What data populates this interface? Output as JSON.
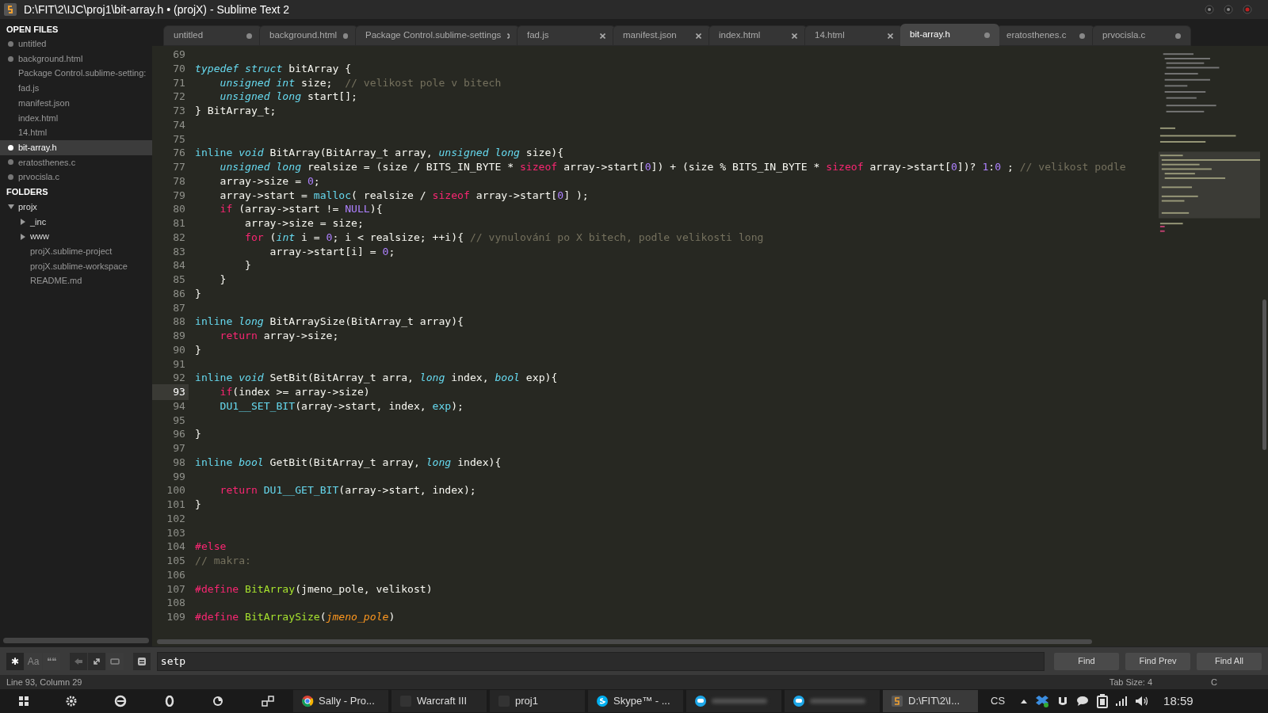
{
  "window": {
    "title": "D:\\FIT\\2\\IJC\\proj1\\bit-array.h • (projX) - Sublime Text 2"
  },
  "tabs": [
    {
      "label": "untitled",
      "selected": false,
      "modified": true
    },
    {
      "label": "background.html",
      "selected": false,
      "modified": true
    },
    {
      "label": "Package Control.sublime-settings",
      "selected": false,
      "modified": false
    },
    {
      "label": "fad.js",
      "selected": false,
      "modified": false
    },
    {
      "label": "manifest.json",
      "selected": false,
      "modified": false
    },
    {
      "label": "index.html",
      "selected": false,
      "modified": false
    },
    {
      "label": "14.html",
      "selected": false,
      "modified": false
    },
    {
      "label": "bit-array.h",
      "selected": true,
      "modified": true
    },
    {
      "label": "eratosthenes.c",
      "selected": false,
      "modified": true
    },
    {
      "label": "prvocisla.c",
      "selected": false,
      "modified": true
    }
  ],
  "sidebar": {
    "open_files_heading": "OPEN FILES",
    "open_files": [
      {
        "label": "untitled",
        "selected": false,
        "modified": true
      },
      {
        "label": "background.html",
        "selected": false,
        "modified": true
      },
      {
        "label": "Package Control.sublime-setting:",
        "selected": false,
        "modified": false
      },
      {
        "label": "fad.js",
        "selected": false,
        "modified": false
      },
      {
        "label": "manifest.json",
        "selected": false,
        "modified": false
      },
      {
        "label": "index.html",
        "selected": false,
        "modified": false
      },
      {
        "label": "14.html",
        "selected": false,
        "modified": false
      },
      {
        "label": "bit-array.h",
        "selected": true,
        "modified": true
      },
      {
        "label": "eratosthenes.c",
        "selected": false,
        "modified": true
      },
      {
        "label": "prvocisla.c",
        "selected": false,
        "modified": true
      }
    ],
    "folders_heading": "FOLDERS",
    "folders": [
      {
        "label": "projx",
        "kind": "folder",
        "expanded": true,
        "children": [
          {
            "label": "_inc",
            "kind": "folder",
            "expanded": false
          },
          {
            "label": "www",
            "kind": "folder",
            "expanded": false
          },
          {
            "label": "projX.sublime-project",
            "kind": "file"
          },
          {
            "label": "projX.sublime-workspace",
            "kind": "file"
          },
          {
            "label": "README.md",
            "kind": "file"
          }
        ]
      }
    ]
  },
  "editor": {
    "lines": [
      {
        "number": "69",
        "current": false
      },
      {
        "number": "70",
        "current": false,
        "tokens": [
          {
            "kind": "type",
            "text": "typedef struct"
          },
          {
            "kind": "plain",
            "text": " bitArray {"
          }
        ]
      },
      {
        "number": "71",
        "current": false,
        "tokens": [
          {
            "kind": "type",
            "text": "    unsigned int"
          },
          {
            "kind": "plain",
            "text": " size;  "
          },
          {
            "kind": "comment",
            "text": "// velikost pole v bitech"
          }
        ]
      },
      {
        "number": "72",
        "current": false,
        "tokens": [
          {
            "kind": "type",
            "text": "    unsigned long"
          },
          {
            "kind": "plain",
            "text": " start[];"
          }
        ]
      },
      {
        "number": "73",
        "current": false,
        "tokens": [
          {
            "kind": "plain",
            "text": "} BitArray_t;"
          }
        ]
      },
      {
        "number": "74",
        "current": false
      },
      {
        "number": "75",
        "current": false
      },
      {
        "number": "76",
        "current": false,
        "tokens": [
          {
            "kind": "storage",
            "text": "inline"
          },
          {
            "kind": "type",
            "text": " void"
          },
          {
            "kind": "plain",
            "text": " BitArray(BitArray_t array, "
          },
          {
            "kind": "type",
            "text": "unsigned long"
          },
          {
            "kind": "plain",
            "text": " size){"
          }
        ]
      },
      {
        "number": "77",
        "current": false,
        "tokens": [
          {
            "kind": "type",
            "text": "    unsigned long"
          },
          {
            "kind": "plain",
            "text": " realsize = (size / BITS_IN_BYTE * "
          },
          {
            "kind": "keyword",
            "text": "sizeof"
          },
          {
            "kind": "plain",
            "text": " array->start["
          },
          {
            "kind": "number",
            "text": "0"
          },
          {
            "kind": "plain",
            "text": "]) + (size % BITS_IN_BYTE * "
          },
          {
            "kind": "keyword",
            "text": "sizeof"
          },
          {
            "kind": "plain",
            "text": " array->start["
          },
          {
            "kind": "number",
            "text": "0"
          },
          {
            "kind": "plain",
            "text": "])? "
          },
          {
            "kind": "number",
            "text": "1"
          },
          {
            "kind": "plain",
            "text": ":"
          },
          {
            "kind": "number",
            "text": "0"
          },
          {
            "kind": "plain",
            "text": " ; "
          },
          {
            "kind": "comment",
            "text": "// velikost podle"
          }
        ]
      },
      {
        "number": "78",
        "current": false,
        "tokens": [
          {
            "kind": "plain",
            "text": "    array->size = "
          },
          {
            "kind": "number",
            "text": "0"
          },
          {
            "kind": "plain",
            "text": ";"
          }
        ]
      },
      {
        "number": "79",
        "current": false,
        "tokens": [
          {
            "kind": "plain",
            "text": "    array->start = "
          },
          {
            "kind": "func",
            "text": "malloc"
          },
          {
            "kind": "plain",
            "text": "( realsize / "
          },
          {
            "kind": "keyword",
            "text": "sizeof"
          },
          {
            "kind": "plain",
            "text": " array->start["
          },
          {
            "kind": "number",
            "text": "0"
          },
          {
            "kind": "plain",
            "text": "] );"
          }
        ]
      },
      {
        "number": "80",
        "current": false,
        "tokens": [
          {
            "kind": "keyword",
            "text": "    if"
          },
          {
            "kind": "plain",
            "text": " (array->start != "
          },
          {
            "kind": "number",
            "text": "NULL"
          },
          {
            "kind": "plain",
            "text": "){"
          }
        ]
      },
      {
        "number": "81",
        "current": false,
        "tokens": [
          {
            "kind": "plain",
            "text": "        array->size = size;"
          }
        ]
      },
      {
        "number": "82",
        "current": false,
        "tokens": [
          {
            "kind": "keyword",
            "text": "        for"
          },
          {
            "kind": "plain",
            "text": " ("
          },
          {
            "kind": "type",
            "text": "int"
          },
          {
            "kind": "plain",
            "text": " i = "
          },
          {
            "kind": "number",
            "text": "0"
          },
          {
            "kind": "plain",
            "text": "; i < realsize; ++i){ "
          },
          {
            "kind": "comment",
            "text": "// vynulování po X bitech, podle velikosti long"
          }
        ]
      },
      {
        "number": "83",
        "current": false,
        "tokens": [
          {
            "kind": "plain",
            "text": "            array->start[i] = "
          },
          {
            "kind": "number",
            "text": "0"
          },
          {
            "kind": "plain",
            "text": ";"
          }
        ]
      },
      {
        "number": "84",
        "current": false,
        "tokens": [
          {
            "kind": "plain",
            "text": "        }"
          }
        ]
      },
      {
        "number": "85",
        "current": false,
        "tokens": [
          {
            "kind": "plain",
            "text": "    }"
          }
        ]
      },
      {
        "number": "86",
        "current": false,
        "tokens": [
          {
            "kind": "plain",
            "text": "}"
          }
        ]
      },
      {
        "number": "87",
        "current": false
      },
      {
        "number": "88",
        "current": false,
        "tokens": [
          {
            "kind": "storage",
            "text": "inline"
          },
          {
            "kind": "type",
            "text": " long"
          },
          {
            "kind": "plain",
            "text": " BitArraySize(BitArray_t array){"
          }
        ]
      },
      {
        "number": "89",
        "current": false,
        "tokens": [
          {
            "kind": "keyword",
            "text": "    return"
          },
          {
            "kind": "plain",
            "text": " array->size;"
          }
        ]
      },
      {
        "number": "90",
        "current": false,
        "tokens": [
          {
            "kind": "plain",
            "text": "}"
          }
        ]
      },
      {
        "number": "91",
        "current": false
      },
      {
        "number": "92",
        "current": false,
        "tokens": [
          {
            "kind": "storage",
            "text": "inline"
          },
          {
            "kind": "type",
            "text": " void"
          },
          {
            "kind": "plain",
            "text": " SetBit(BitArray_t arra, "
          },
          {
            "kind": "type",
            "text": "long"
          },
          {
            "kind": "plain",
            "text": " index, "
          },
          {
            "kind": "type",
            "text": "bool"
          },
          {
            "kind": "plain",
            "text": " exp){"
          }
        ]
      },
      {
        "number": "93",
        "current": true,
        "tokens": [
          {
            "kind": "keyword",
            "text": "    if"
          },
          {
            "kind": "plain",
            "text": "(index >= array->size)"
          }
        ]
      },
      {
        "number": "94",
        "current": false,
        "tokens": [
          {
            "kind": "func",
            "text": "    DU1__SET_BIT"
          },
          {
            "kind": "plain",
            "text": "(array->start, index, "
          },
          {
            "kind": "func",
            "text": "exp"
          },
          {
            "kind": "plain",
            "text": ");"
          }
        ]
      },
      {
        "number": "95",
        "current": false
      },
      {
        "number": "96",
        "current": false,
        "tokens": [
          {
            "kind": "plain",
            "text": "}"
          }
        ]
      },
      {
        "number": "97",
        "current": false
      },
      {
        "number": "98",
        "current": false,
        "tokens": [
          {
            "kind": "storage",
            "text": "inline"
          },
          {
            "kind": "type",
            "text": " bool"
          },
          {
            "kind": "plain",
            "text": " GetBit(BitArray_t array, "
          },
          {
            "kind": "type",
            "text": "long"
          },
          {
            "kind": "plain",
            "text": " index){"
          }
        ]
      },
      {
        "number": "99",
        "current": false
      },
      {
        "number": "100",
        "current": false,
        "tokens": [
          {
            "kind": "keyword",
            "text": "    return"
          },
          {
            "kind": "func",
            "text": " DU1__GET_BIT"
          },
          {
            "kind": "plain",
            "text": "(array->start, index);"
          }
        ]
      },
      {
        "number": "101",
        "current": false,
        "tokens": [
          {
            "kind": "plain",
            "text": "}"
          }
        ]
      },
      {
        "number": "102",
        "current": false
      },
      {
        "number": "103",
        "current": false
      },
      {
        "number": "104",
        "current": false,
        "tokens": [
          {
            "kind": "keyword",
            "text": "#else"
          }
        ]
      },
      {
        "number": "105",
        "current": false,
        "tokens": [
          {
            "kind": "comment",
            "text": "// makra:"
          }
        ]
      },
      {
        "number": "106",
        "current": false
      },
      {
        "number": "107",
        "current": false,
        "tokens": [
          {
            "kind": "keyword",
            "text": "#define"
          },
          {
            "kind": "name",
            "text": " BitArray"
          },
          {
            "kind": "plain",
            "text": "(jmeno_pole, velikost)"
          }
        ]
      },
      {
        "number": "108",
        "current": false
      },
      {
        "number": "109",
        "current": false,
        "tokens": [
          {
            "kind": "keyword",
            "text": "#define"
          },
          {
            "kind": "name",
            "text": " BitArraySize"
          },
          {
            "kind": "plain",
            "text": "("
          },
          {
            "kind": "param",
            "text": "jmeno_pole"
          },
          {
            "kind": "plain",
            "text": ")"
          }
        ]
      }
    ]
  },
  "find_bar": {
    "toggles": [
      {
        "label": "✱",
        "on": true
      },
      {
        "label": "Aa",
        "on": false
      },
      {
        "label": "❝❝",
        "on": false
      }
    ],
    "query": "setp",
    "buttons": [
      "Find",
      "Find Prev",
      "Find All"
    ]
  },
  "status_bar": {
    "position": "Line 93, Column 29",
    "tab_size": "Tab Size: 4",
    "syntax": "C"
  },
  "taskbar": {
    "tasks": [
      {
        "kind": "app",
        "label": "Sally - Pro..."
      },
      {
        "kind": "app",
        "label": "Warcraft III"
      },
      {
        "kind": "app",
        "label": "proj1"
      },
      {
        "kind": "app",
        "label": "Skype™ - ..."
      },
      {
        "kind": "blurred"
      },
      {
        "kind": "blurred"
      },
      {
        "kind": "app",
        "label": "D:\\FIT\\2\\I...",
        "selected": true
      }
    ],
    "language": "CS",
    "clock": "18:59"
  }
}
